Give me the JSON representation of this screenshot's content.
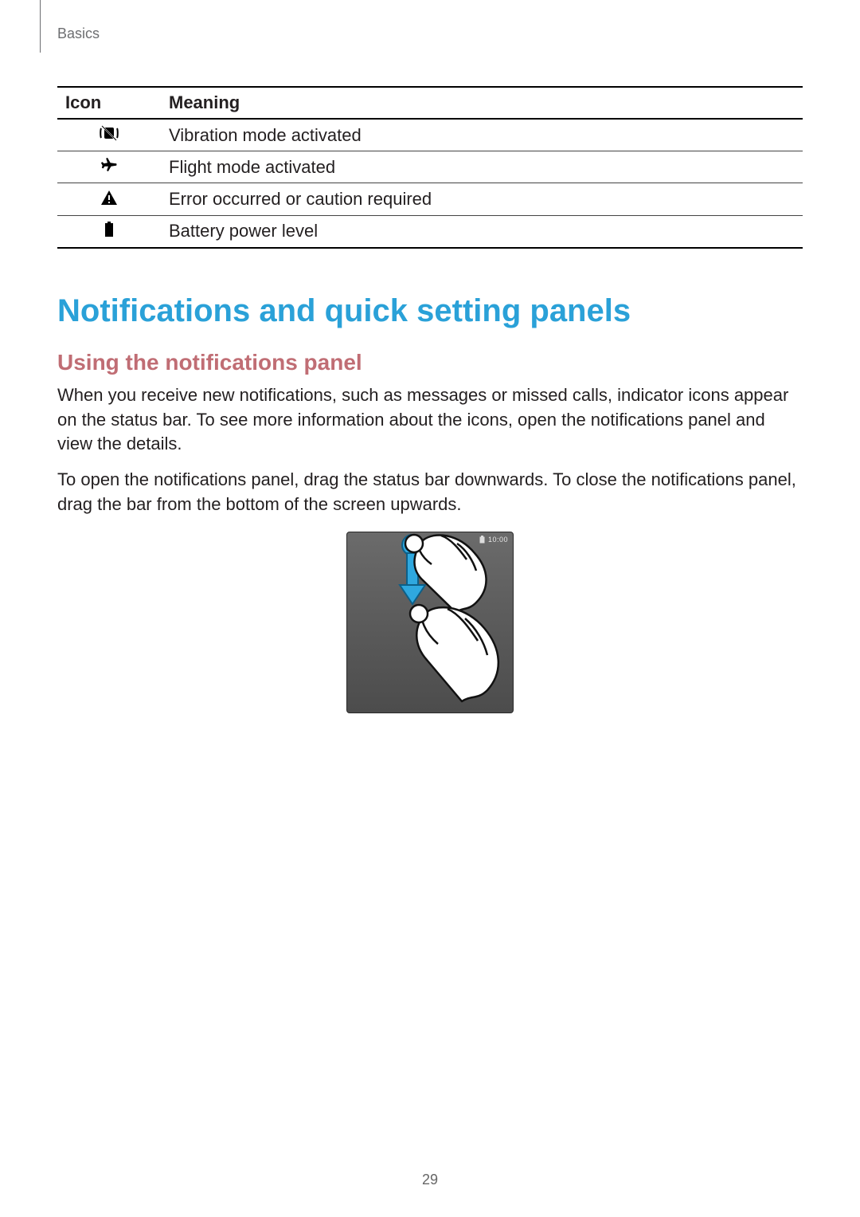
{
  "breadcrumb": "Basics",
  "table": {
    "headers": {
      "icon": "Icon",
      "meaning": "Meaning"
    },
    "rows": [
      {
        "icon": "vibration-icon",
        "meaning": "Vibration mode activated"
      },
      {
        "icon": "airplane-icon",
        "meaning": "Flight mode activated"
      },
      {
        "icon": "warning-icon",
        "meaning": "Error occurred or caution required"
      },
      {
        "icon": "battery-icon",
        "meaning": "Battery power level"
      }
    ]
  },
  "headings": {
    "h1": "Notifications and quick setting panels",
    "h2": "Using the notifications panel"
  },
  "paragraphs": {
    "p1": "When you receive new notifications, such as messages or missed calls, indicator icons appear on the status bar. To see more information about the icons, open the notifications panel and view the details.",
    "p2": "To open the notifications panel, drag the status bar downwards. To close the notifications panel, drag the bar from the bottom of the screen upwards."
  },
  "illustration": {
    "status_time": "10:00"
  },
  "page_number": "29"
}
